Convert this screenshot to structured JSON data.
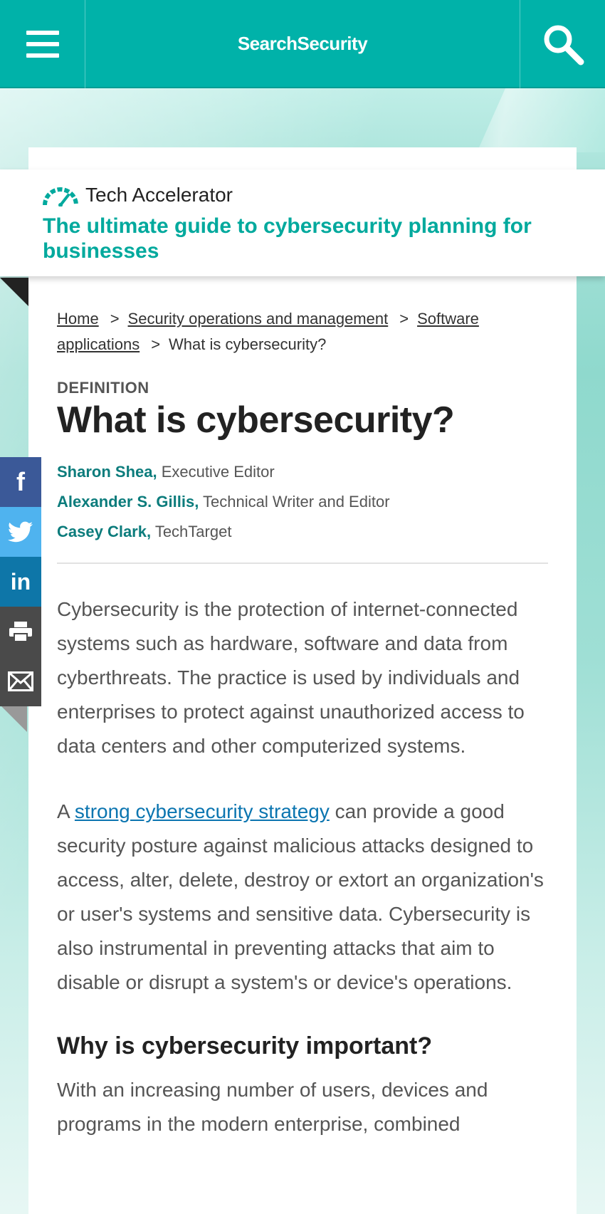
{
  "header": {
    "brand": "SearchSecurity",
    "menu_icon": "hamburger-menu-icon",
    "search_icon": "search-icon",
    "color": "#00b2a9"
  },
  "banner": {
    "label": "Tech Accelerator",
    "title": "The ultimate guide to cybersecurity planning for businesses",
    "icon": "speedometer-icon",
    "accent": "#00a99d"
  },
  "breadcrumb": [
    {
      "label": "Home",
      "link": true
    },
    {
      "label": "Security operations and management",
      "link": true
    },
    {
      "label": "Software applications",
      "link": true
    },
    {
      "label": "What is cybersecurity?",
      "link": false
    }
  ],
  "article": {
    "kicker": "DEFINITION",
    "title": "What is cybersecurity?",
    "authors": [
      {
        "name": "Sharon Shea,",
        "role": "Executive Editor"
      },
      {
        "name": "Alexander S. Gillis,",
        "role": "Technical Writer and Editor"
      },
      {
        "name": "Casey Clark,",
        "role": "TechTarget"
      }
    ],
    "intro": "Cybersecurity is the protection of internet-connected systems such as hardware, software and data from cyberthreats. The practice is used by individuals and enterprises to protect against unauthorized access to data centers and other computerized systems.",
    "p2_start": "A ",
    "p2_link": "strong cybersecurity strategy",
    "p2_rest": " can provide a good security posture against malicious attacks designed to access, alter, delete, destroy or extort an organization's or user's systems and sensitive data. Cybersecurity is also instrumental in preventing attacks that aim to disable or disrupt a system's or device's operations.",
    "h2": "Why is cybersecurity important?",
    "p3": "With an increasing number of users, devices and programs in the modern enterprise, combined"
  },
  "share": [
    {
      "name": "facebook",
      "icon": "facebook-icon",
      "glyph": "f",
      "color": "#3b5998"
    },
    {
      "name": "twitter",
      "icon": "twitter-icon",
      "glyph": "",
      "color": "#4fb3ef"
    },
    {
      "name": "linkedin",
      "icon": "linkedin-icon",
      "glyph": "in",
      "color": "#0e76a8"
    },
    {
      "name": "print",
      "icon": "print-icon",
      "glyph": "",
      "color": "#4a4a4a"
    },
    {
      "name": "email",
      "icon": "email-icon",
      "glyph": "",
      "color": "#4a4a4a"
    }
  ]
}
